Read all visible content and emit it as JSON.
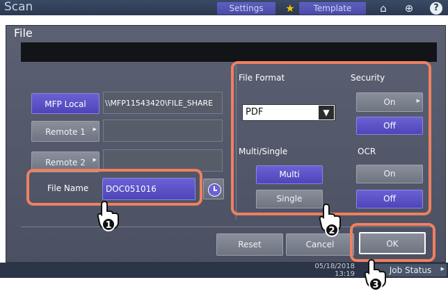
{
  "background": {
    "app_title": "Scan",
    "settings_label": "Settings",
    "template_label": "Template",
    "job_status_label": "Job Status",
    "clock_date": "05/18/2018",
    "clock_time": "13:19"
  },
  "dialog": {
    "title": "File",
    "left": {
      "mfp_local_label": "MFP Local",
      "mfp_local_path": "\\\\MFP11543420\\FILE_SHARE",
      "remote1_label": "Remote 1",
      "remote2_label": "Remote 2",
      "file_name_label": "File Name",
      "file_name_value": "DOC051016"
    },
    "right": {
      "file_format_label": "File Format",
      "file_format_value": "PDF",
      "security_label": "Security",
      "security_on": "On",
      "security_off": "Off",
      "multi_single_label": "Multi/Single",
      "multi_label": "Multi",
      "single_label": "Single",
      "ocr_label": "OCR",
      "ocr_on": "On",
      "ocr_off": "Off"
    },
    "footer": {
      "reset_label": "Reset",
      "cancel_label": "Cancel",
      "ok_label": "OK"
    }
  },
  "callouts": [
    "1",
    "2",
    "3"
  ],
  "colors": {
    "highlight": "#f08060",
    "selected": "#5a52c8",
    "dialog_bg": "#555b6b"
  }
}
